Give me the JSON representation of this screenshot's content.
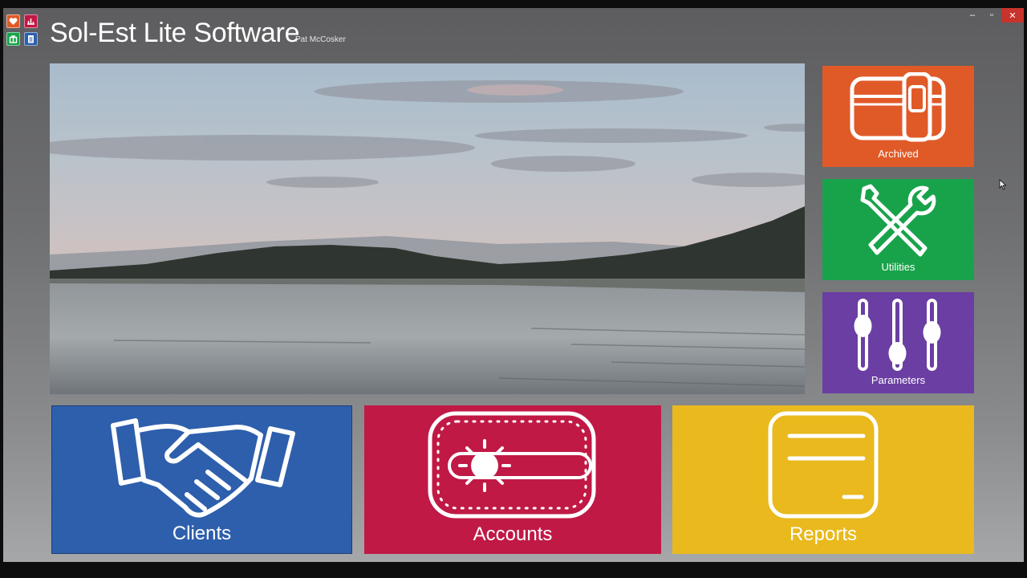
{
  "window": {
    "title": "Sol-Est Lite Software",
    "author": "Pat McCosker",
    "controls": {
      "minimize": "–",
      "maximize": "▫",
      "close": "✕"
    }
  },
  "app_icons": [
    {
      "icon": "heart-icon",
      "color": "#e05a28"
    },
    {
      "icon": "chart-icon",
      "color": "#c01946"
    },
    {
      "icon": "gift-icon",
      "color": "#18a34a"
    },
    {
      "icon": "document-icon",
      "color": "#2e5fac"
    }
  ],
  "photo": {
    "description_icon": "landscape-photo"
  },
  "tiles": {
    "archived": {
      "label": "Archived",
      "icon": "archive-box-icon",
      "color": "#e05a28"
    },
    "utilities": {
      "label": "Utilities",
      "icon": "tools-icon",
      "color": "#18a34a"
    },
    "parameters": {
      "label": "Parameters",
      "icon": "sliders-icon",
      "color": "#6a3ea2"
    },
    "clients": {
      "label": "Clients",
      "icon": "handshake-icon",
      "color": "#2e5fac"
    },
    "accounts": {
      "label": "Accounts",
      "icon": "money-card-icon",
      "color": "#c01946"
    },
    "reports": {
      "label": "Reports",
      "icon": "report-icon",
      "color": "#e9b91d"
    }
  }
}
